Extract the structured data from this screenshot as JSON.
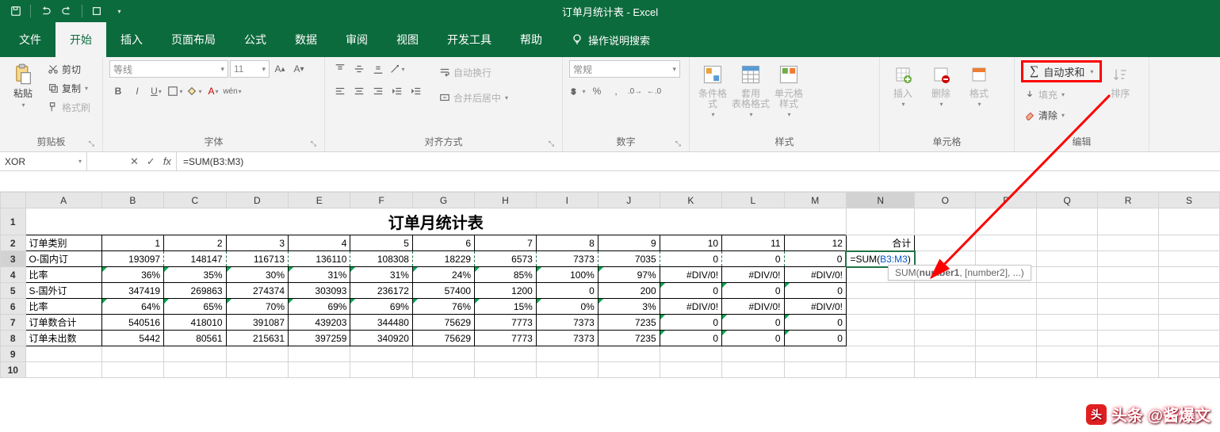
{
  "app": {
    "title": "订单月统计表 - Excel"
  },
  "tabs": [
    "文件",
    "开始",
    "插入",
    "页面布局",
    "公式",
    "数据",
    "审阅",
    "视图",
    "开发工具",
    "帮助"
  ],
  "active_tab_index": 1,
  "tell_me": "操作说明搜索",
  "ribbon": {
    "clipboard": {
      "paste": "粘贴",
      "cut": "剪切",
      "copy": "复制",
      "painter": "格式刷",
      "label": "剪贴板"
    },
    "font": {
      "face": "等线",
      "size": "11",
      "label": "字体"
    },
    "align": {
      "wrap": "自动换行",
      "merge": "合并后居中",
      "label": "对齐方式"
    },
    "number": {
      "fmt": "常规",
      "label": "数字"
    },
    "styles": {
      "cond": "条件格式",
      "table": "套用\n表格格式",
      "cell": "单元格样式",
      "label": "样式"
    },
    "cells": {
      "insert": "插入",
      "delete": "删除",
      "format": "格式",
      "label": "单元格"
    },
    "editing": {
      "autosum": "自动求和",
      "fill": "填充",
      "clear": "清除",
      "sort": "排序",
      "label": "编辑"
    }
  },
  "namebox": "XOR",
  "formula": "=SUM(B3:M3)",
  "tooltip": {
    "prefix": "SUM(",
    "bold": "number1",
    "rest": ", [number2], ...)"
  },
  "chart_data": {
    "type": "table",
    "title": "订单月统计表",
    "columns": [
      "订单类别",
      "1",
      "2",
      "3",
      "4",
      "5",
      "6",
      "7",
      "8",
      "9",
      "10",
      "11",
      "12",
      "合计"
    ],
    "rows": [
      {
        "label": "O-国内订",
        "values": [
          193097,
          148147,
          116713,
          136110,
          108308,
          18229,
          6573,
          7373,
          7035,
          0,
          0,
          0
        ],
        "total_formula": "=SUM(B3:M3)"
      },
      {
        "label": "比率",
        "values": [
          "36%",
          "35%",
          "30%",
          "31%",
          "31%",
          "24%",
          "85%",
          "100%",
          "97%",
          "#DIV/0!",
          "#DIV/0!",
          "#DIV/0!"
        ]
      },
      {
        "label": "S-国外订",
        "values": [
          347419,
          269863,
          274374,
          303093,
          236172,
          57400,
          1200,
          0,
          200,
          0,
          0,
          0
        ]
      },
      {
        "label": "比率",
        "values": [
          "64%",
          "65%",
          "70%",
          "69%",
          "69%",
          "76%",
          "15%",
          "0%",
          "3%",
          "#DIV/0!",
          "#DIV/0!",
          "#DIV/0!"
        ]
      },
      {
        "label": "订单数合计",
        "values": [
          540516,
          418010,
          391087,
          439203,
          344480,
          75629,
          7773,
          7373,
          7235,
          0,
          0,
          0
        ]
      },
      {
        "label": "订单未出数",
        "values": [
          5442,
          80561,
          215631,
          397259,
          340920,
          75629,
          7773,
          7373,
          7235,
          0,
          0,
          0
        ]
      }
    ]
  },
  "col_letters": [
    "A",
    "B",
    "C",
    "D",
    "E",
    "F",
    "G",
    "H",
    "I",
    "J",
    "K",
    "L",
    "M",
    "N",
    "O",
    "P",
    "Q",
    "R",
    "S"
  ],
  "watermark": "头条 @酱爆文"
}
